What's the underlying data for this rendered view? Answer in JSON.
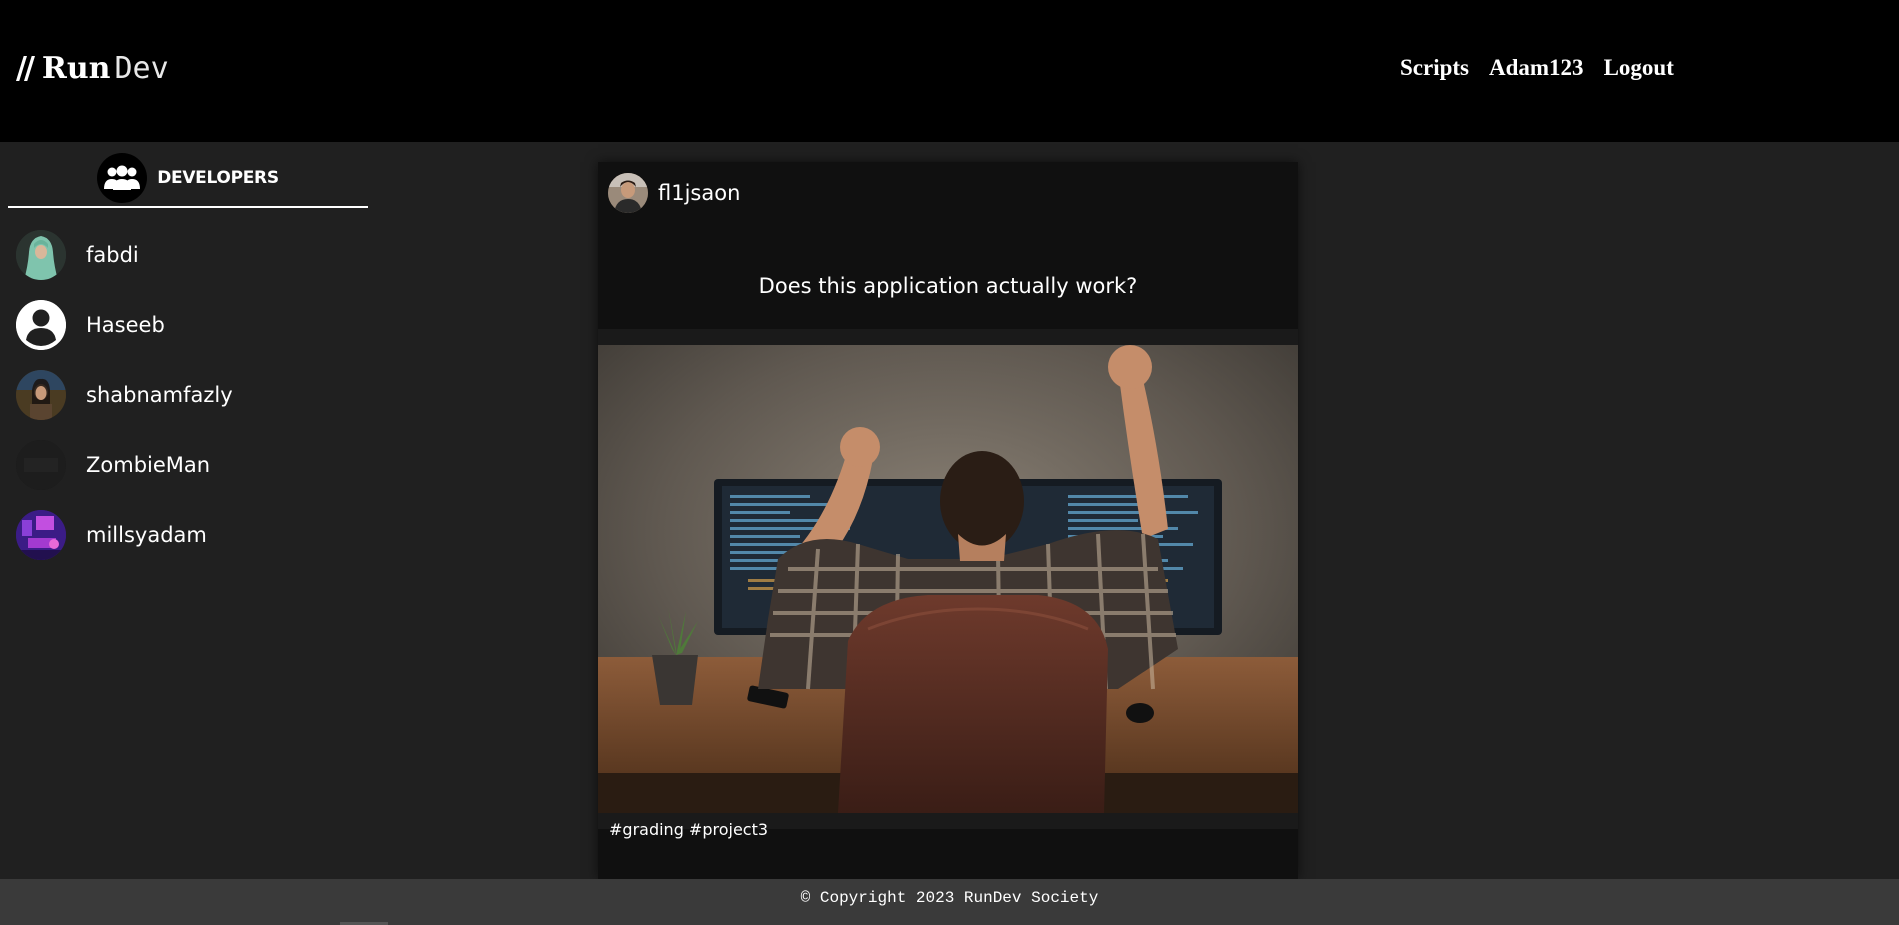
{
  "brand": {
    "slashes": "//",
    "run": "Run",
    "dev": "Dev"
  },
  "nav": {
    "scripts": "Scripts",
    "user": "Adam123",
    "logout": "Logout"
  },
  "sidebar": {
    "header_label": "DEVELOPERS",
    "header_icon": "group-icon",
    "developers": [
      {
        "name": "fabdi",
        "avatar": "avatar-photo"
      },
      {
        "name": "Haseeb",
        "avatar": "default-user-icon"
      },
      {
        "name": "shabnamfazly",
        "avatar": "avatar-photo"
      },
      {
        "name": "ZombieMan",
        "avatar": "avatar-photo"
      },
      {
        "name": "millsyadam",
        "avatar": "avatar-photo"
      }
    ]
  },
  "post": {
    "author": "fl1jsaon",
    "question": "Does this application actually work?",
    "tags": "#grading #project3",
    "image": "developer-celebrating-at-desk-photo"
  },
  "footer": {
    "copyright": "© Copyright 2023 RunDev Society"
  },
  "colors": {
    "header_bg": "#000000",
    "page_bg": "#202020",
    "post_bg": "#101010",
    "footer_bg": "#3a3a3a"
  }
}
